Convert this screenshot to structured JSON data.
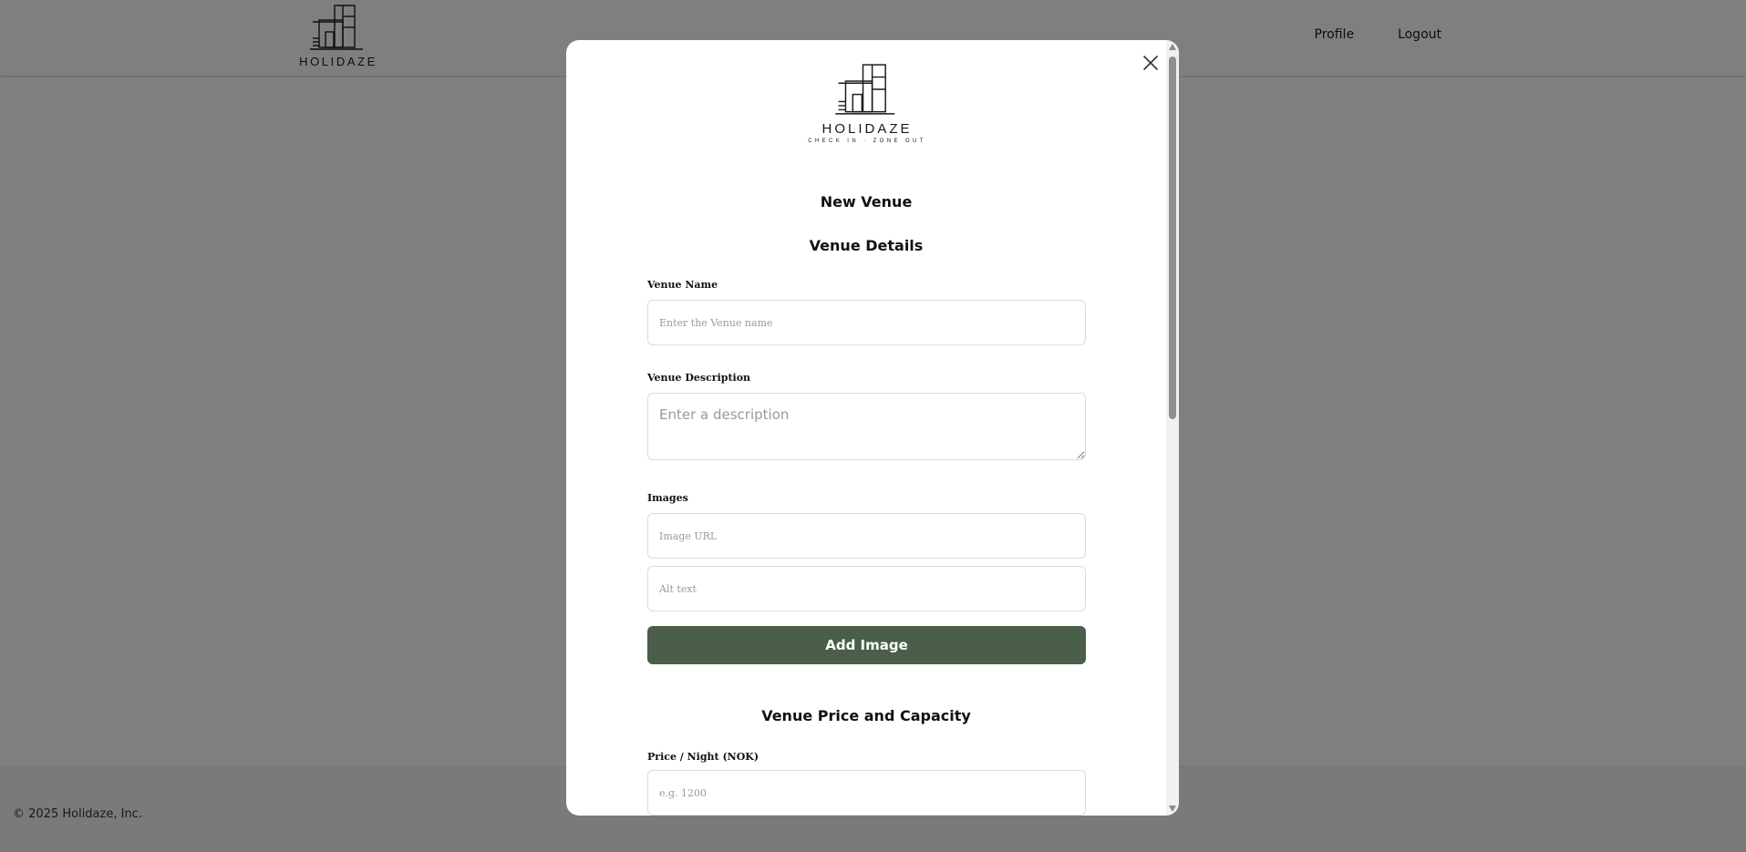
{
  "header": {
    "brand": "HOLIDAZE",
    "nav": {
      "profile_label": "Profile",
      "logout_label": "Logout"
    }
  },
  "footer": {
    "copyright": "© 2025 Holidaze, Inc."
  },
  "modal": {
    "brand": "HOLIDAZE",
    "tagline": "CHECK IN · ZONE OUT",
    "title": "New Venue",
    "details_section": {
      "heading": "Venue Details",
      "venue_name": {
        "label": "Venue Name",
        "placeholder": "Enter the Venue name",
        "value": ""
      },
      "venue_description": {
        "label": "Venue Description",
        "placeholder": "Enter a description",
        "value": ""
      },
      "images": {
        "label": "Images",
        "url_placeholder": "Image URL",
        "alt_placeholder": "Alt text",
        "add_button_label": "Add Image"
      }
    },
    "price_section": {
      "heading": "Venue Price and Capacity",
      "price": {
        "label": "Price / Night (NOK)",
        "placeholder": "e.g. 1200",
        "value": ""
      }
    }
  },
  "colors": {
    "accent_button": "#4a5e4a",
    "overlay": "rgba(0,0,0,0.5)",
    "footer_bg": "#f4f4f4"
  },
  "icons": [
    "holidaze-logo-icon",
    "close-icon"
  ]
}
